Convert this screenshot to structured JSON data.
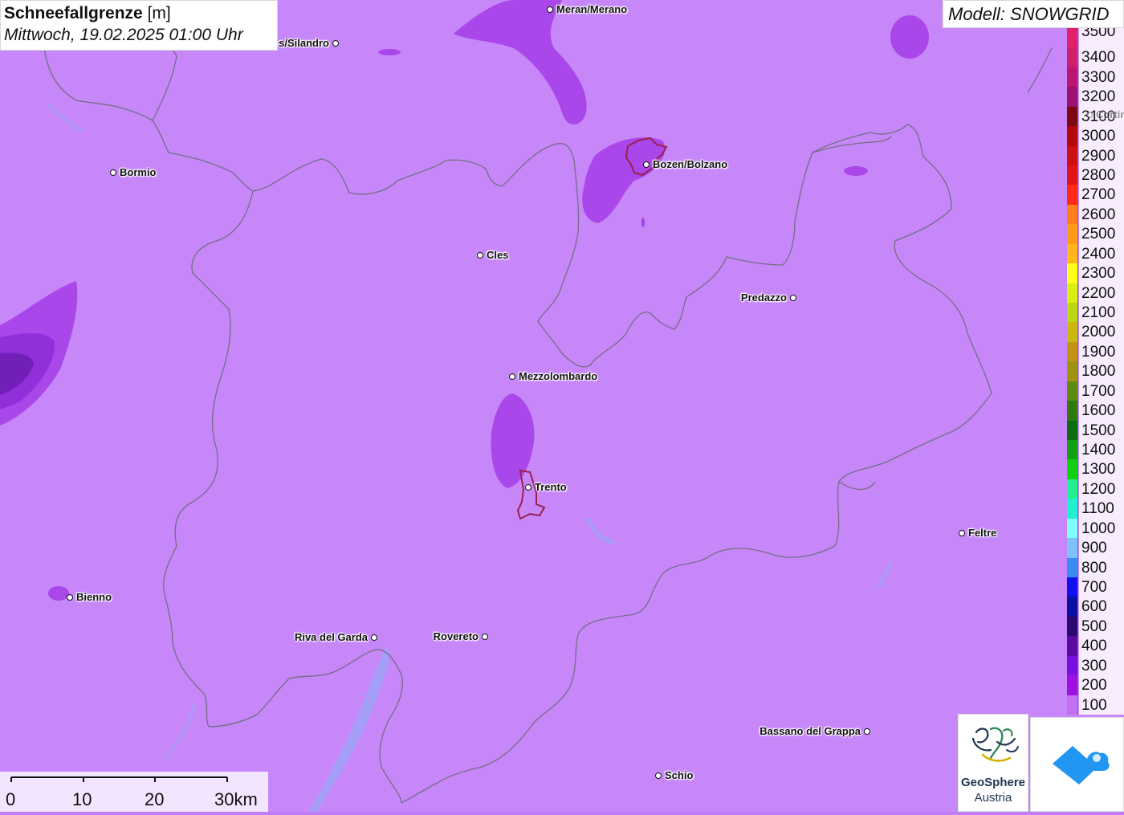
{
  "header": {
    "title_bold": "Schneefallgrenze",
    "title_unit": "[m]",
    "datetime": "Mittwoch, 19.02.2025 01:00 Uhr"
  },
  "model_label": "Modell: SNOWGRID",
  "legend": {
    "entries": [
      {
        "label": "3500",
        "color": "#e0206a"
      },
      {
        "label": "3400",
        "color": "#d01e6e"
      },
      {
        "label": "3300",
        "color": "#b81670"
      },
      {
        "label": "3200",
        "color": "#9c1070"
      },
      {
        "label": "3100",
        "color": "#7a0a10"
      },
      {
        "label": "3000",
        "color": "#b00a0a"
      },
      {
        "label": "2900",
        "color": "#cc0f0f"
      },
      {
        "label": "2800",
        "color": "#e01414"
      },
      {
        "label": "2700",
        "color": "#ff2a1a"
      },
      {
        "label": "2600",
        "color": "#ff7f1a"
      },
      {
        "label": "2500",
        "color": "#ff9a1a"
      },
      {
        "label": "2400",
        "color": "#ffb61a"
      },
      {
        "label": "2300",
        "color": "#ffff1a"
      },
      {
        "label": "2200",
        "color": "#d8f010"
      },
      {
        "label": "2100",
        "color": "#b8d810"
      },
      {
        "label": "2000",
        "color": "#c8b810"
      },
      {
        "label": "1900",
        "color": "#c09410"
      },
      {
        "label": "1800",
        "color": "#9c9410"
      },
      {
        "label": "1700",
        "color": "#5c8c10"
      },
      {
        "label": "1600",
        "color": "#2e7a10"
      },
      {
        "label": "1500",
        "color": "#0a6e10"
      },
      {
        "label": "1400",
        "color": "#10a010"
      },
      {
        "label": "1300",
        "color": "#10d010"
      },
      {
        "label": "1200",
        "color": "#20f090"
      },
      {
        "label": "1100",
        "color": "#20f0d0"
      },
      {
        "label": "1000",
        "color": "#80ffff"
      },
      {
        "label": "900",
        "color": "#80c0f8"
      },
      {
        "label": "800",
        "color": "#3a8cf0"
      },
      {
        "label": "700",
        "color": "#1010f0"
      },
      {
        "label": "600",
        "color": "#0a10a0"
      },
      {
        "label": "500",
        "color": "#2a0a70"
      },
      {
        "label": "400",
        "color": "#5a0aa0"
      },
      {
        "label": "300",
        "color": "#7a10e0"
      },
      {
        "label": "200",
        "color": "#a010e0"
      },
      {
        "label": "100",
        "color": "#c070f0"
      }
    ]
  },
  "cities": [
    {
      "name": "Meran/Merano",
      "side": "right"
    },
    {
      "name": "s/Silandro",
      "side": "left"
    },
    {
      "name": "Bormio",
      "side": "right"
    },
    {
      "name": "Bozen/Bolzano",
      "side": "right"
    },
    {
      "name": "Cles",
      "side": "right"
    },
    {
      "name": "Predazzo",
      "side": "left"
    },
    {
      "name": "Mezzolombardo",
      "side": "right"
    },
    {
      "name": "Trento",
      "side": "right"
    },
    {
      "name": "Feltre",
      "side": "right"
    },
    {
      "name": "Bienno",
      "side": "right"
    },
    {
      "name": "Riva del Garda",
      "side": "left"
    },
    {
      "name": "Rovereto",
      "side": "left"
    },
    {
      "name": "Bassano del Grappa",
      "side": "left"
    },
    {
      "name": "Schio",
      "side": "right"
    },
    {
      "name": "Cortin",
      "side": "right",
      "faded": true
    }
  ],
  "scale": {
    "labels": [
      "0",
      "10",
      "20",
      "30km"
    ]
  },
  "logos": {
    "geosphere_line1": "GeoSphere",
    "geosphere_line2": "Austria"
  },
  "colors": {
    "base_100m": "#c17cf8",
    "zone_200m": "#a640e8",
    "zone_300m": "#8e2cd8",
    "zone_400m": "#6a1cb0",
    "border": "#6a6a78",
    "urban_outline": "#9a2050",
    "water": "#9aa6f6",
    "accent_blue": "#2196f3"
  }
}
